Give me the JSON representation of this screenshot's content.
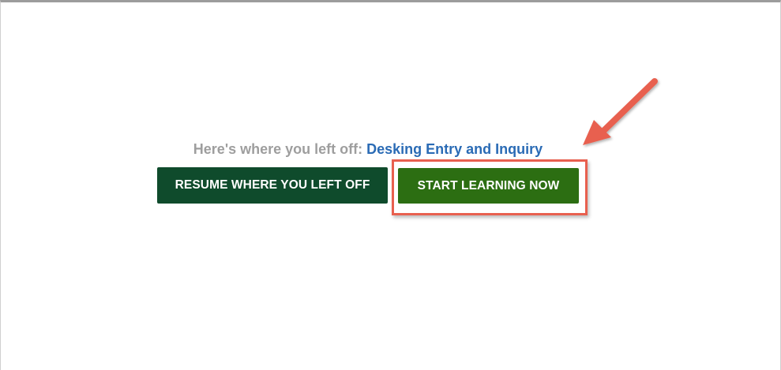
{
  "resume_section": {
    "prefix": "Here's where you left off:",
    "course_link": "Desking Entry and Inquiry"
  },
  "buttons": {
    "resume_label": "RESUME WHERE YOU LEFT OFF",
    "start_label": "START LEARNING NOW"
  },
  "annotation": {
    "arrow_icon": "arrow-pointer-icon",
    "highlight_color": "#e8604f"
  },
  "colors": {
    "resume_button": "#0f4b2c",
    "start_button": "#2c6e12",
    "link": "#2a6bb5",
    "prefix_text": "#9e9e9e"
  }
}
